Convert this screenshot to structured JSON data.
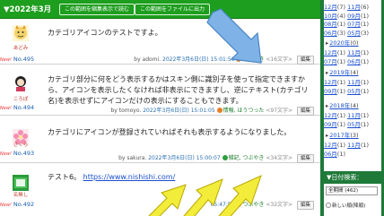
{
  "header": {
    "title": "▼2022年3月",
    "btn_zip": "この範囲を縮集表示で読む",
    "btn_file": "この範囲をファイルに出力"
  },
  "posts": [
    {
      "author": "あどみ",
      "new_label": "New!",
      "number": "No.495",
      "body": "カテゴリアイコンのテストですよ。",
      "by": "by adomi.",
      "date": "2022年3月6日(日) 15:01:56",
      "category": "つぶやき",
      "chars": "<16文字>",
      "edit": "編集"
    },
    {
      "author": "ころぽ",
      "new_label": "New!",
      "number": "No.494",
      "body": "カテゴリ部分に何をどう表示するかはスキン側に識別子を使って指定できますから、アイコンを表示したくなければ非表示にできますし、逆にテキスト(カテゴリ名)を表示せずにアイコンだけの表示にすることもできます。",
      "by": "by tomoyo.",
      "date": "2022年3月6日(日) 15:01:05",
      "category": "情報, はうつった",
      "chars": "<97文字>",
      "edit": "編集"
    },
    {
      "author": "さくら",
      "new_label": "New!",
      "number": "No.493",
      "body": "カテゴリにアイコンが登録されていればそれも表示するようになりました。",
      "by": "by sakura.",
      "date": "2022年3月6日(日) 15:00:07",
      "category": "雑記, つぶやき",
      "chars": "<34文字>",
      "edit": "編集"
    },
    {
      "author": "名無し",
      "new_label": "New!",
      "number": "No.492",
      "body_prefix": "テスト6。",
      "link": "https://www.nishishi.com/",
      "date": "05:47:56",
      "category": "つぶやき",
      "chars": "<32文字>",
      "edit": "編集"
    }
  ],
  "sidebar": {
    "months_2021": [
      {
        "a": "12月",
        "ac": "(7)",
        "b": "11月",
        "bc": "(6)"
      },
      {
        "a": "10月",
        "ac": "(4)",
        "b": "09月",
        "bc": "(1)"
      },
      {
        "a": "08月",
        "ac": "(1)",
        "b": "07月",
        "bc": "(1)"
      },
      {
        "a": "06月",
        "ac": "(3)",
        "b": "05月",
        "bc": "(3)"
      }
    ],
    "year_2020": "2020年",
    "year_2020_count": "(0)",
    "months_2020": [
      {
        "a": "12月",
        "ac": "(1)",
        "b": "11月",
        "bc": "(1)"
      },
      {
        "a": "07月",
        "ac": "(1)",
        "b": "06月",
        "bc": "(1)"
      }
    ],
    "year_2019": "2019年",
    "year_2019_count": "(4)",
    "months_2019": [
      {
        "a": "12月",
        "ac": "(1)",
        "b": "11月",
        "bc": "(1)"
      },
      {
        "a": "09月",
        "ac": "(1)",
        "b": "05月",
        "bc": "(1)"
      }
    ],
    "year_2018": "2018年",
    "year_2018_count": "(4)",
    "months_2018": [
      {
        "a": "12月",
        "ac": "(1)",
        "b": "11月",
        "bc": "(1)"
      },
      {
        "a": "09月",
        "ac": "(1)",
        "b": "05月",
        "bc": "(1)"
      }
    ],
    "year_2017": "2017年",
    "year_2017_count": "(3)",
    "months_2017": [
      {
        "a": "12月",
        "ac": "(1)",
        "b": "11月",
        "bc": "(1)"
      },
      {
        "a": "06月",
        "ac": "(1)",
        "b": "",
        "bc": ""
      }
    ],
    "search_title": "▼日付検索：",
    "select_value": "全期間 (462)",
    "radio_label": "新しい順(降順)"
  }
}
